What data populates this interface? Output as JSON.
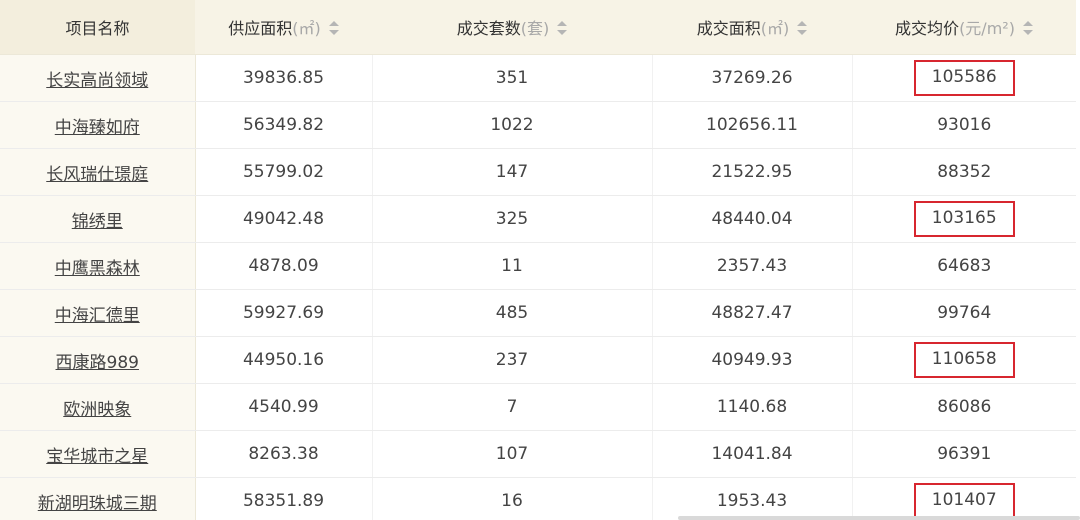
{
  "table": {
    "headers": [
      {
        "label": "项目名称",
        "unit": ""
      },
      {
        "label": "供应面积",
        "unit": "(㎡)"
      },
      {
        "label": "成交套数",
        "unit": "(套)"
      },
      {
        "label": "成交面积",
        "unit": "(㎡)"
      },
      {
        "label": "成交均价",
        "unit": "(元/m²)"
      }
    ],
    "rows": [
      {
        "name": "长实高尚领域",
        "supply": "39836.85",
        "units": "351",
        "area": "37269.26",
        "price": "105586",
        "highlighted": true
      },
      {
        "name": "中海臻如府",
        "supply": "56349.82",
        "units": "1022",
        "area": "102656.11",
        "price": "93016",
        "highlighted": false
      },
      {
        "name": "长风瑞仕璟庭",
        "supply": "55799.02",
        "units": "147",
        "area": "21522.95",
        "price": "88352",
        "highlighted": false
      },
      {
        "name": "锦绣里",
        "supply": "49042.48",
        "units": "325",
        "area": "48440.04",
        "price": "103165",
        "highlighted": true
      },
      {
        "name": "中鹰黑森林",
        "supply": "4878.09",
        "units": "11",
        "area": "2357.43",
        "price": "64683",
        "highlighted": false
      },
      {
        "name": "中海汇德里",
        "supply": "59927.69",
        "units": "485",
        "area": "48827.47",
        "price": "99764",
        "highlighted": false
      },
      {
        "name": "西康路989",
        "supply": "44950.16",
        "units": "237",
        "area": "40949.93",
        "price": "110658",
        "highlighted": true
      },
      {
        "name": "欧洲映象",
        "supply": "4540.99",
        "units": "7",
        "area": "1140.68",
        "price": "86086",
        "highlighted": false
      },
      {
        "name": "宝华城市之星",
        "supply": "8263.38",
        "units": "107",
        "area": "14041.84",
        "price": "96391",
        "highlighted": false
      },
      {
        "name": "新湖明珠城三期",
        "supply": "58351.89",
        "units": "16",
        "area": "1953.43",
        "price": "101407",
        "highlighted": true
      }
    ]
  },
  "colors": {
    "header_bg": "#f7f3e6",
    "name_column_bg": "#fbf9f1",
    "highlight_border": "#d7262f",
    "unit_text": "#a8a8a8"
  }
}
